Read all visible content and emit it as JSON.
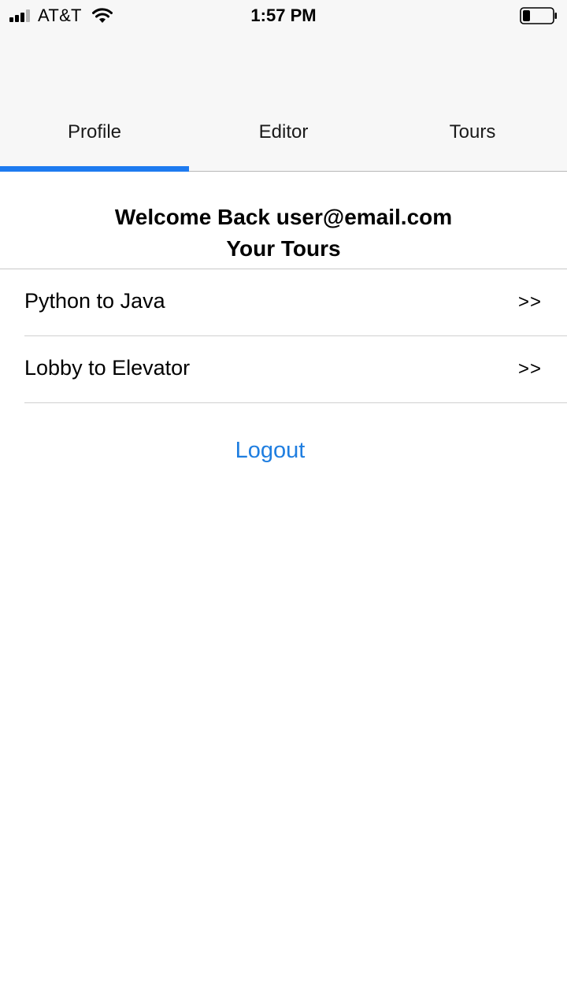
{
  "status_bar": {
    "carrier": "AT&T",
    "time": "1:57 PM",
    "battery_level": 0.25
  },
  "tabs": [
    {
      "label": "Profile",
      "active": true
    },
    {
      "label": "Editor",
      "active": false
    },
    {
      "label": "Tours",
      "active": false
    }
  ],
  "welcome": {
    "line1": "Welcome Back user@email.com",
    "line2": "Your Tours"
  },
  "tours": [
    {
      "name": "Python to Java",
      "chevron": ">>"
    },
    {
      "name": "Lobby to Elevator",
      "chevron": ">>"
    }
  ],
  "logout_label": "Logout",
  "colors": {
    "accent": "#1e7bf0",
    "link": "#1f7ee0",
    "header_bg": "#f7f7f7"
  }
}
